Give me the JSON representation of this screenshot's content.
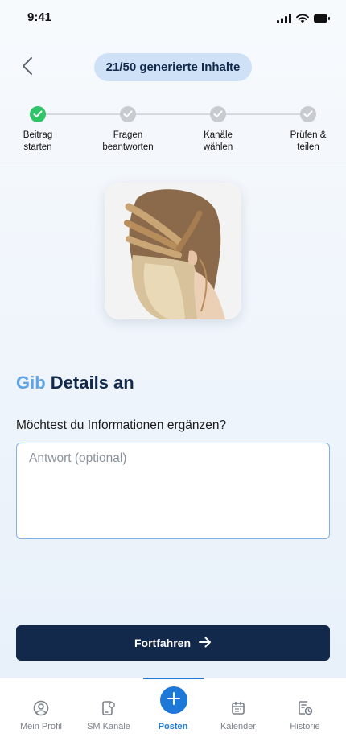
{
  "status_bar": {
    "time": "9:41"
  },
  "header": {
    "back_icon": "chevron-left-icon",
    "counter": "21/50 generierte Inhalte"
  },
  "stepper": {
    "steps": [
      {
        "label": "Beitrag\nstarten",
        "state": "done"
      },
      {
        "label": "Fragen\nbeantworten",
        "state": "pending"
      },
      {
        "label": "Kanäle\nwählen",
        "state": "pending"
      },
      {
        "label": "Prüfen &\nteilen",
        "state": "pending"
      }
    ]
  },
  "image": {
    "description_icon": "hairstyle-photo"
  },
  "section": {
    "title_accent": "Gib",
    "title_rest": "Details an"
  },
  "question": {
    "label": "Möchtest du Informationen ergänzen?",
    "placeholder": "Antwort (optional)",
    "value": ""
  },
  "continue_button": {
    "label": "Fortfahren",
    "icon": "arrow-right-icon"
  },
  "bottom_nav": {
    "items": [
      {
        "label": "Mein Profil",
        "icon": "profile-icon",
        "active": false
      },
      {
        "label": "SM Kanäle",
        "icon": "channels-icon",
        "active": false
      },
      {
        "label": "Posten",
        "icon": "plus-icon",
        "active": true
      },
      {
        "label": "Kalender",
        "icon": "calendar-icon",
        "active": false
      },
      {
        "label": "Historie",
        "icon": "history-icon",
        "active": false
      }
    ]
  },
  "colors": {
    "primary_dark": "#13294b",
    "accent_blue": "#1e78d7",
    "accent_light": "#5ea3e6",
    "pill_bg": "#cfe1f7",
    "success": "#2fc468"
  }
}
